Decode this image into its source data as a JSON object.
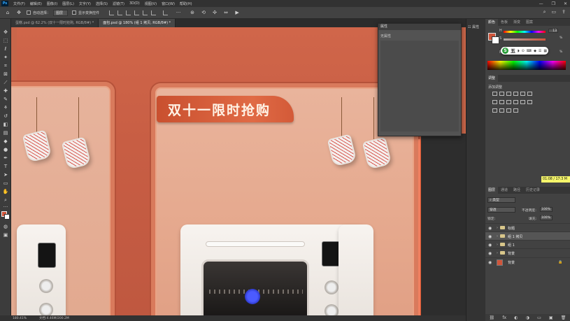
{
  "menu": {
    "logo": "Ps",
    "items": [
      "文件(F)",
      "编辑(E)",
      "图像(I)",
      "图层(L)",
      "文字(Y)",
      "选择(S)",
      "滤镜(T)",
      "3D(D)",
      "视图(V)",
      "窗口(W)",
      "帮助(H)"
    ],
    "window_controls": {
      "minimize": "—",
      "maximize": "❐",
      "close": "✕"
    }
  },
  "options": {
    "auto_select_label": "自动选择：",
    "auto_select_value": "图层",
    "show_transform_label": "显示变换控件",
    "right_icons": [
      "⌕",
      "▭",
      "⇪"
    ]
  },
  "tabs": [
    {
      "label": "蛋糕.psd @ 62.2% (双十一限时抢购, RGB/8#) *",
      "active": false
    },
    {
      "label": "面包.psd @ 180% (组 1 拷贝, RGB/8#) *",
      "active": true
    }
  ],
  "canvas": {
    "promo_text": "双十一限时抢购"
  },
  "properties_panel": {
    "title": "属性",
    "subtitle": "无属性"
  },
  "status": {
    "zoom": "180.41%",
    "doc_info": "文档:4.46M/200.2M"
  },
  "icon_strip": {
    "properties_label": "属性"
  },
  "color_panel": {
    "tabs": [
      "颜色",
      "色板",
      "渐变",
      "图案"
    ],
    "active_tab": "颜色",
    "fg_color": "#d0553a",
    "bg_color": "#ffffff",
    "sliders": [
      {
        "label": "H",
        "value": "13",
        "unit": ""
      },
      {
        "label": "S",
        "value": "",
        "unit": "%"
      },
      {
        "label": "B",
        "value": "",
        "unit": "%"
      }
    ],
    "ime": {
      "logo": "S",
      "text": "五",
      "icons": [
        "◗",
        "⊙",
        "⌨",
        "◆",
        "☰",
        "▦"
      ]
    }
  },
  "adjust_panel": {
    "tabs": [
      "调整"
    ],
    "hint": "添加调整"
  },
  "tooltip": "01:08 / 17:3 M",
  "layers_panel": {
    "tabs": [
      "图层",
      "通道",
      "路径",
      "历史记录"
    ],
    "filter_label": "类型",
    "blend_mode": "穿透",
    "opacity_label": "不透明度:",
    "opacity_value": "100%",
    "lock_label": "锁定:",
    "fill_label": "填充:",
    "fill_value": "100%",
    "layers": [
      {
        "name": "标题",
        "type": "group",
        "selected": false
      },
      {
        "name": "组 1 拷贝",
        "type": "group",
        "selected": true
      },
      {
        "name": "组 1",
        "type": "group",
        "selected": false
      },
      {
        "name": "背景",
        "type": "group",
        "selected": false
      },
      {
        "name": "背景",
        "type": "fill",
        "selected": false
      }
    ],
    "footer_icons": [
      "⛓",
      "fx",
      "◐",
      "◑",
      "▭",
      "▣",
      "🗑"
    ]
  }
}
